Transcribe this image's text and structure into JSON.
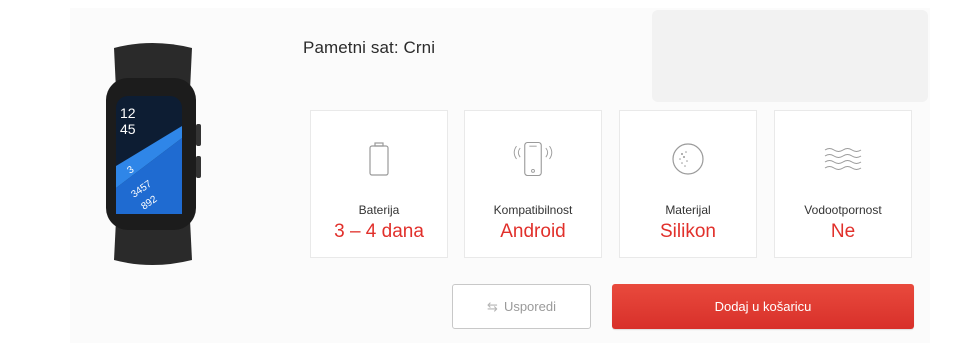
{
  "product": {
    "title": "Pametni sat: Crni",
    "watch_screen": {
      "time_hours": "12",
      "time_minutes": "45",
      "stat1": "3",
      "stat2": "3457",
      "stat3": "892"
    }
  },
  "specs": [
    {
      "icon": "battery-icon",
      "label": "Baterija",
      "value": "3 – 4 dana"
    },
    {
      "icon": "phone-vibrate-icon",
      "label": "Kompatibilnost",
      "value": "Android"
    },
    {
      "icon": "material-icon",
      "label": "Materijal",
      "value": "Silikon"
    },
    {
      "icon": "water-waves-icon",
      "label": "Vodootpornost",
      "value": "Ne"
    }
  ],
  "actions": {
    "compare_label": "Usporedi",
    "add_to_cart_label": "Dodaj u košaricu"
  },
  "colors": {
    "accent": "#e1302b",
    "button_red": "#dd3a30"
  }
}
